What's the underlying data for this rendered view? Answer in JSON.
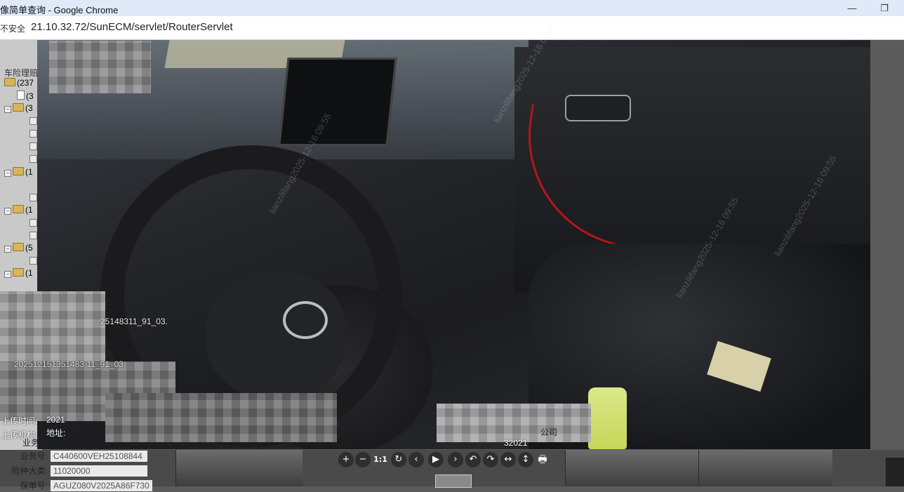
{
  "browser": {
    "title": "像简单查询 - Google Chrome",
    "security_label": "不安全",
    "url": "21.10.32.72/SunECM/servlet/RouterServlet"
  },
  "tree": {
    "root_label": "车险理赔",
    "rows": [
      {
        "kind": "folder",
        "label": "(237",
        "expanded": false
      },
      {
        "kind": "doc",
        "label": "(3"
      },
      {
        "kind": "folder",
        "label": "(3",
        "expanded": true
      },
      {
        "kind": "folder",
        "label": "(1",
        "expanded": true
      },
      {
        "kind": "folder",
        "label": "(1",
        "expanded": true
      },
      {
        "kind": "folder",
        "label": "(5",
        "expanded": true
      },
      {
        "kind": "folder",
        "label": "(1",
        "expanded": true
      }
    ]
  },
  "overlay": {
    "filename_1": "25148311_91_03.",
    "filename_2": "202512151351483 11_91_03.",
    "upload_time_label": "上传时间:",
    "upload_time_value": "2021",
    "upload_org_label": "上传机构:",
    "address_label": "地址:",
    "company_fragment": "公司",
    "code_fragment": "32021"
  },
  "form": {
    "rows": [
      {
        "label": "业务号:",
        "value": "C440600VEH25108844"
      },
      {
        "label": "险种大类:",
        "value": "11020000"
      },
      {
        "label": "保单号:",
        "value": "AGUZ080V2025A86F730"
      }
    ],
    "business_type_label": "业务类"
  },
  "toolbar": {
    "buttons": [
      {
        "name": "zoom-in-button",
        "glyph": "+"
      },
      {
        "name": "zoom-out-button",
        "glyph": "−"
      },
      {
        "name": "actual-size-button",
        "glyph": "1:1"
      },
      {
        "name": "reset-button",
        "glyph": "↻"
      },
      {
        "name": "prev-button",
        "glyph": "‹"
      },
      {
        "name": "play-button",
        "glyph": "▶"
      },
      {
        "name": "next-button",
        "glyph": "›"
      },
      {
        "name": "rotate-left-button",
        "glyph": "↶"
      },
      {
        "name": "rotate-right-button",
        "glyph": "↷"
      },
      {
        "name": "flip-horizontal-button",
        "glyph": "↔"
      },
      {
        "name": "flip-vertical-button",
        "glyph": "↕"
      },
      {
        "name": "print-button",
        "glyph": "🖶"
      }
    ]
  },
  "watermark_text": "lianzilifang2025-12-16 09:55"
}
